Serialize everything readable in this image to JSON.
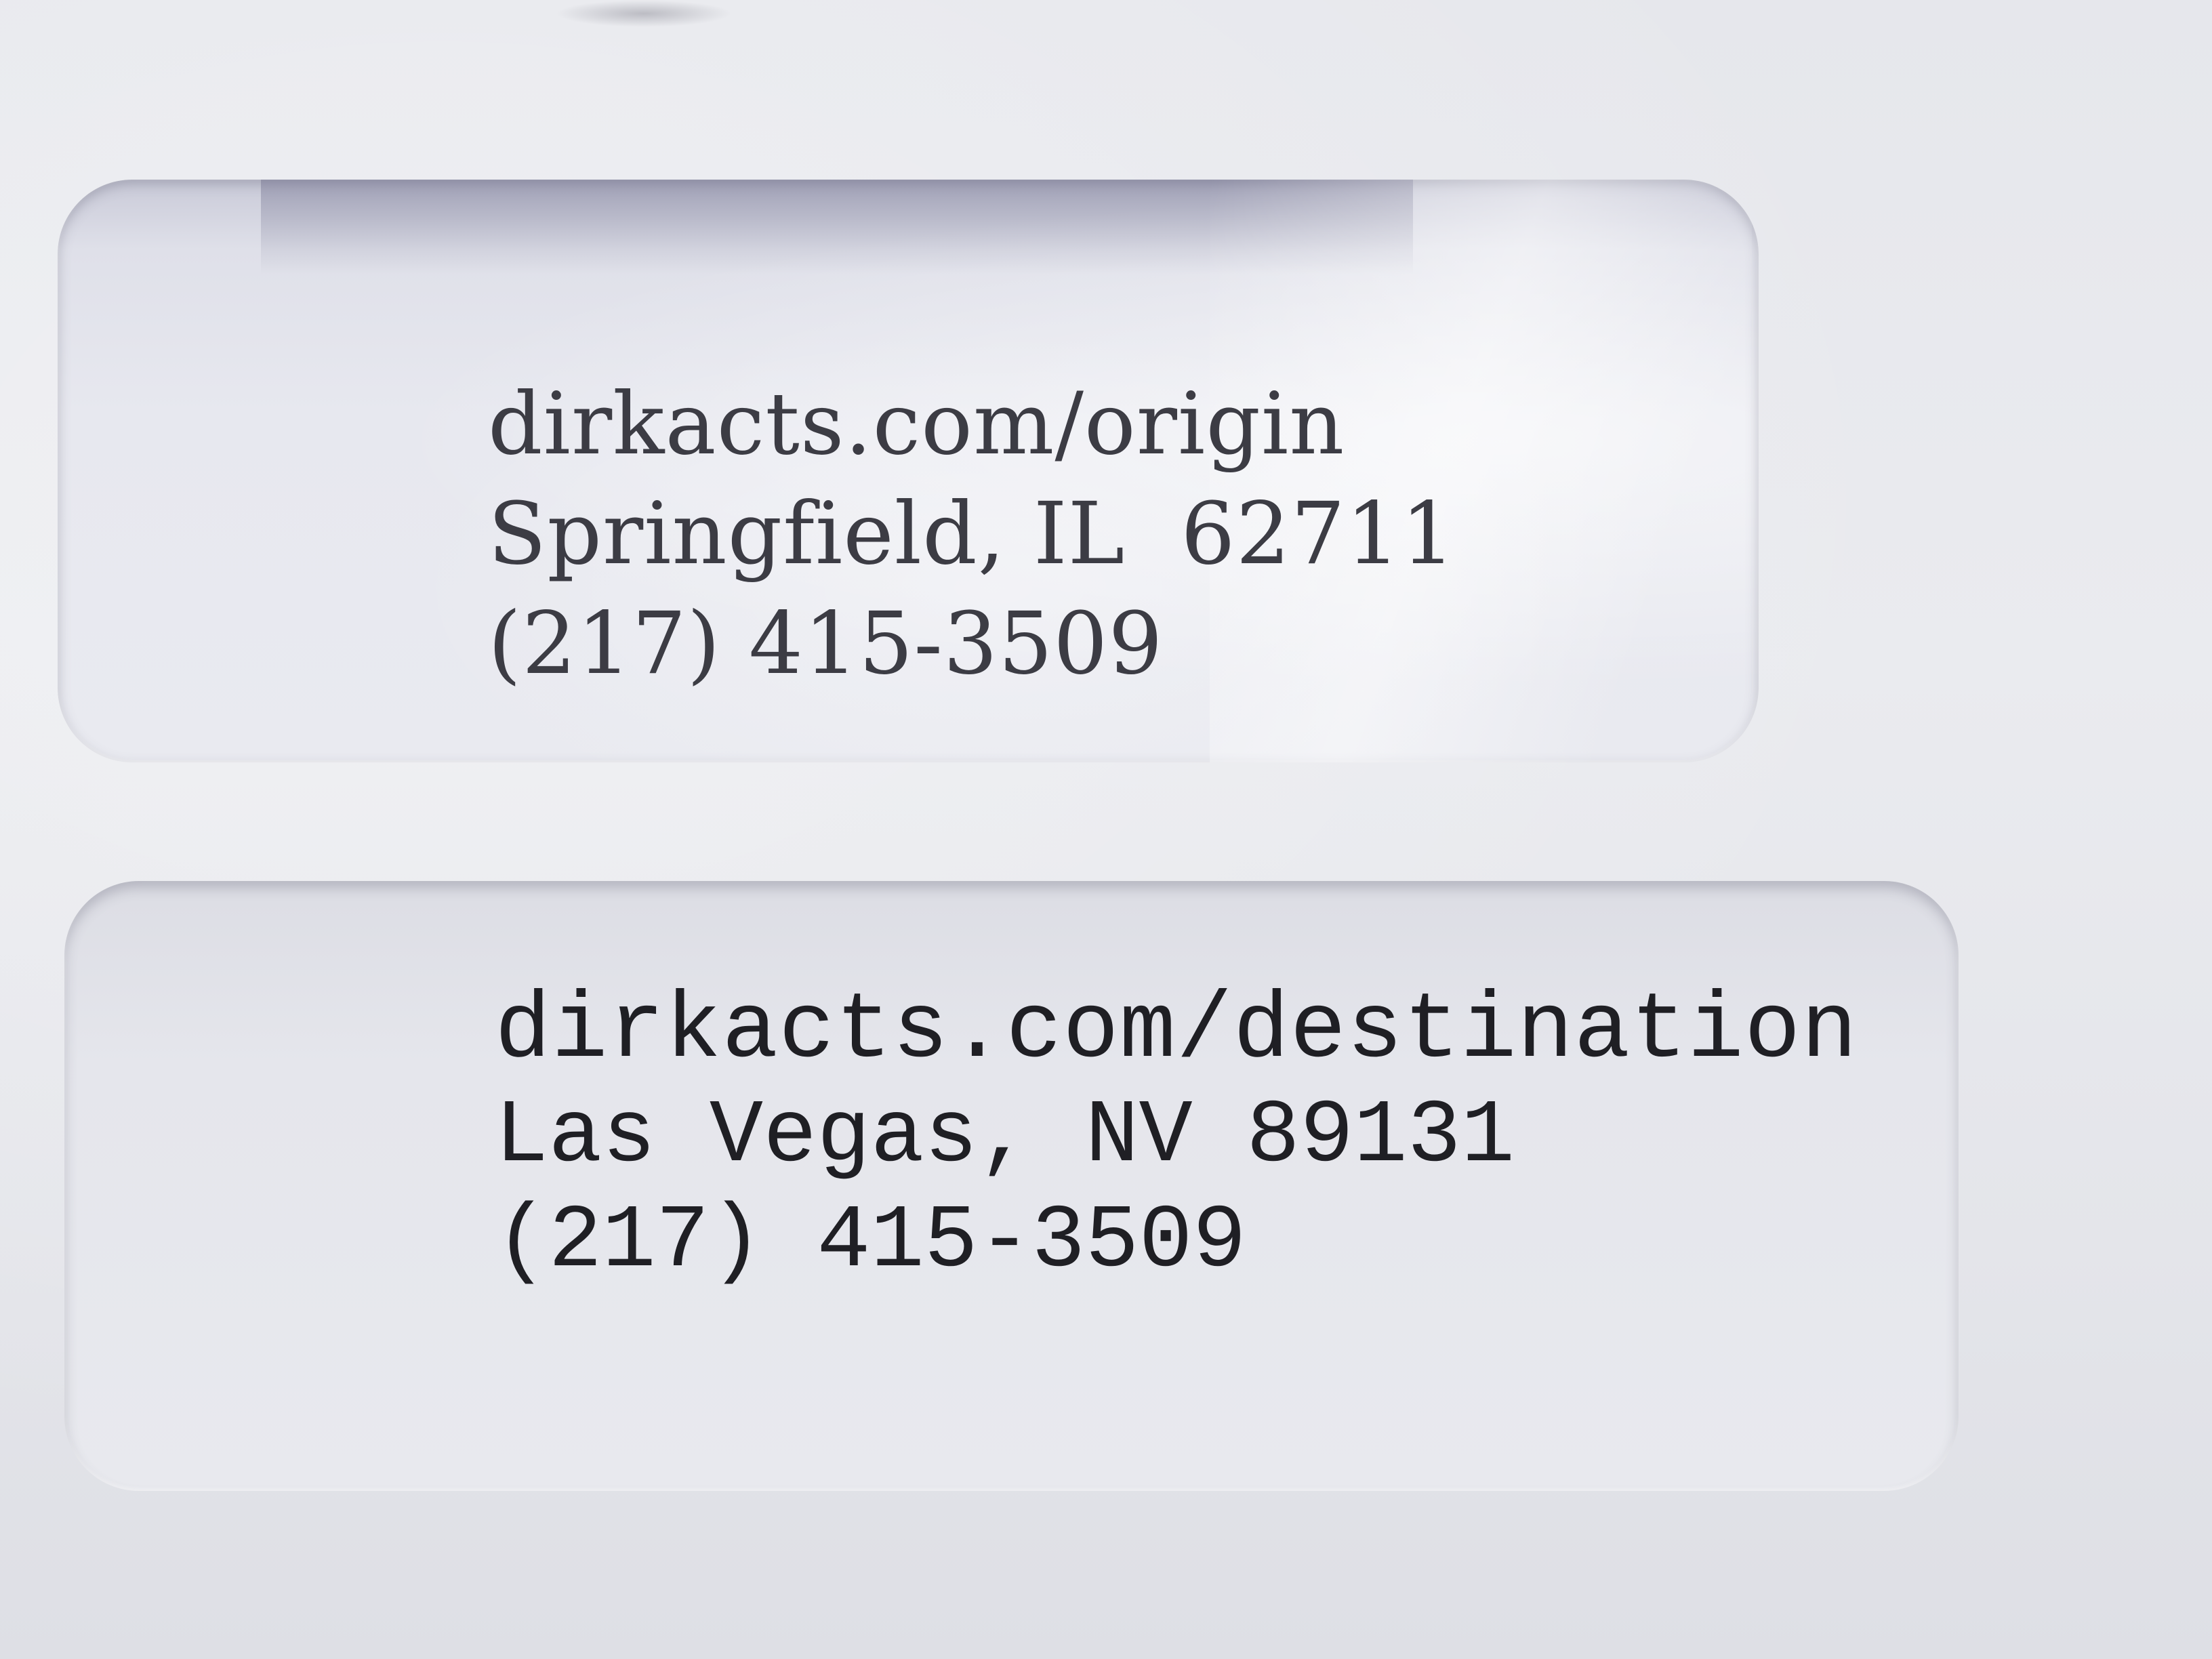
{
  "origin": {
    "line1": "dirkacts.com/origin",
    "line2": "Springfield, IL  62711",
    "line3": "(217) 415-3509"
  },
  "destination": {
    "line1": "dirkacts.com/destination",
    "line2": "Las Vegas, NV 89131",
    "line3": "(217) 415-3509"
  }
}
